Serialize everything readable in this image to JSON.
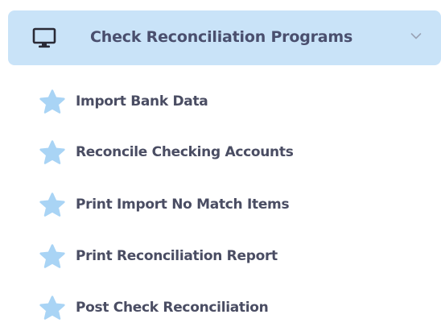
{
  "menu": {
    "header": {
      "title": "Check Reconciliation Programs",
      "icon": "monitor-icon",
      "expanded": true
    },
    "items": [
      {
        "label": "Import Bank Data",
        "icon": "star-icon"
      },
      {
        "label": "Reconcile Checking Accounts",
        "icon": "star-icon"
      },
      {
        "label": "Print Import No Match Items",
        "icon": "star-icon"
      },
      {
        "label": "Print Reconciliation Report",
        "icon": "star-icon"
      },
      {
        "label": "Post Check Reconciliation",
        "icon": "star-icon"
      }
    ]
  },
  "colors": {
    "header_background": "#c9e3f8",
    "text": "#4a4d63",
    "star": "#a9d4f5"
  }
}
